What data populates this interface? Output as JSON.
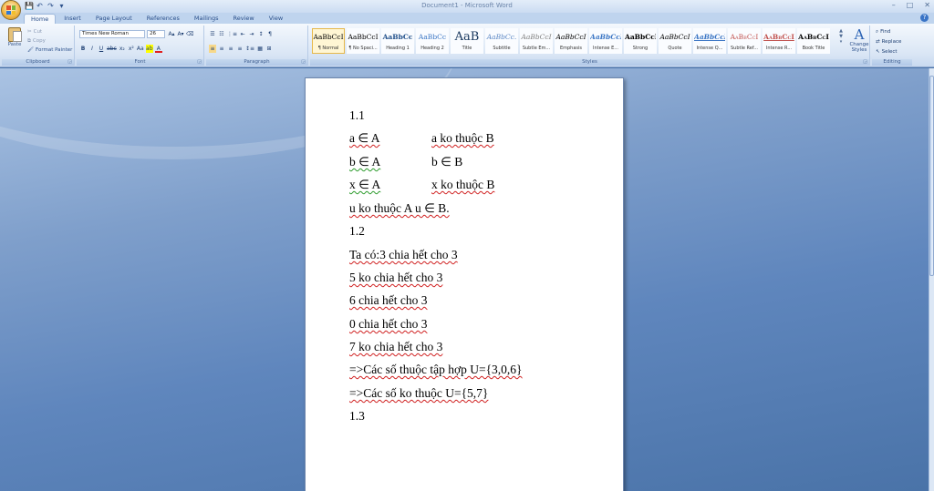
{
  "window": {
    "title": "Document1 - Microsoft Word",
    "controls": [
      "–",
      "□",
      "✕"
    ]
  },
  "quick_access": [
    "💾",
    "↶",
    "↷",
    "▾"
  ],
  "tabs": [
    "Home",
    "Insert",
    "Page Layout",
    "References",
    "Mailings",
    "Review",
    "View"
  ],
  "help_label": "?",
  "clipboard": {
    "label": "Clipboard",
    "paste": "Paste",
    "cut": "Cut",
    "copy": "Copy",
    "format_painter": "Format Painter"
  },
  "font": {
    "label": "Font",
    "name": "Times New Roman",
    "size": "26",
    "row1": [
      "A▴",
      "A▾",
      "⌫"
    ],
    "row2": [
      "B",
      "I",
      "U",
      "abc",
      "x₂",
      "x²",
      "Aa",
      "ab",
      "A"
    ]
  },
  "paragraph": {
    "label": "Paragraph",
    "row1": [
      "☰",
      "☷",
      "⋮≡",
      "⇤",
      "⇥",
      "↕",
      "¶"
    ],
    "row2": [
      "≡",
      "≡",
      "≡",
      "≡",
      "↕≡",
      "▦",
      "⊞"
    ]
  },
  "styles": {
    "label": "Styles",
    "items": [
      {
        "preview": "AaBbCcI",
        "name": "¶ Normal"
      },
      {
        "preview": "AaBbCcI",
        "name": "¶ No Spaci..."
      },
      {
        "preview": "AaBbCc",
        "name": "Heading 1"
      },
      {
        "preview": "AaBbCc",
        "name": "Heading 2"
      },
      {
        "preview": "AaB",
        "name": "Title"
      },
      {
        "preview": "AaBbCc.",
        "name": "Subtitle"
      },
      {
        "preview": "AaBbCcI",
        "name": "Subtle Em..."
      },
      {
        "preview": "AaBbCcI",
        "name": "Emphasis"
      },
      {
        "preview": "AaBbCcI",
        "name": "Intense E..."
      },
      {
        "preview": "AaBbCcI",
        "name": "Strong"
      },
      {
        "preview": "AaBbCcI",
        "name": "Quote"
      },
      {
        "preview": "AaBbCcI",
        "name": "Intense Q..."
      },
      {
        "preview": "AaBbCcI",
        "name": "Subtle Ref..."
      },
      {
        "preview": "AaBbCcI",
        "name": "Intense R..."
      },
      {
        "preview": "AaBbCcI",
        "name": "Book Title"
      }
    ],
    "change_styles": "Change Styles"
  },
  "editing": {
    "label": "Editing",
    "find": "Find",
    "replace": "Replace",
    "select": "Select"
  },
  "document": {
    "lines": [
      {
        "a": "1.1",
        "b": ""
      },
      {
        "a": "a ∈ A",
        "b": "a ko thuộc B"
      },
      {
        "a": "b ∈ A",
        "b": "b ∈ B"
      },
      {
        "a": "x ∈ A",
        "b": "x ko thuộc B"
      },
      {
        "a": "u ko thuộc A    u ∈ B.",
        "b": ""
      },
      {
        "a": "1.2",
        "b": ""
      },
      {
        "a": "Ta có:3 chia hết cho 3",
        "b": ""
      },
      {
        "a": "5 ko chia hết cho 3",
        "b": ""
      },
      {
        "a": "6 chia hết cho 3",
        "b": ""
      },
      {
        "a": "0 chia hết cho 3",
        "b": ""
      },
      {
        "a": "7 ko chia hết cho 3",
        "b": ""
      },
      {
        "a": "=>Các số thuộc tập hợp U={3,0,6}",
        "b": ""
      },
      {
        "a": "=>Các số ko thuộc U={5,7}",
        "b": ""
      },
      {
        "a": "1.3",
        "b": ""
      }
    ]
  }
}
